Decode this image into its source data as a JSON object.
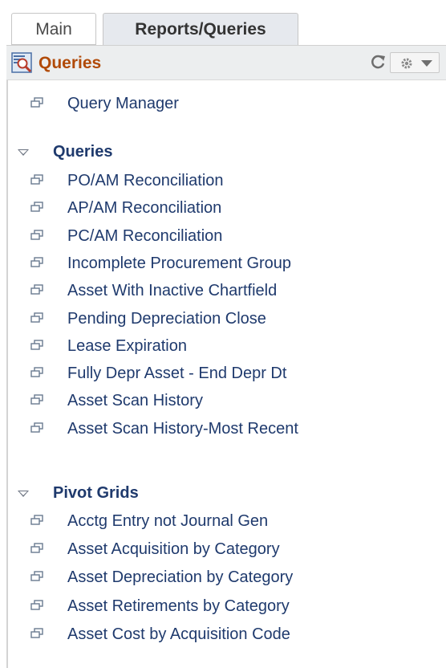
{
  "tabs": [
    {
      "label": "Main",
      "active": false
    },
    {
      "label": "Reports/Queries",
      "active": true
    }
  ],
  "header": {
    "title": "Queries",
    "icon": "query-report-icon",
    "title_color": "#b14a08"
  },
  "top_link": {
    "label": "Query Manager",
    "icon": "link-icon"
  },
  "groups": [
    {
      "title": "Queries",
      "expanded": true,
      "items": [
        "PO/AM Reconciliation",
        "AP/AM Reconciliation",
        "PC/AM Reconciliation",
        "Incomplete Procurement Group",
        "Asset With Inactive Chartfield",
        "Pending Depreciation Close",
        "Lease Expiration",
        "Fully Depr Asset - End Depr Dt",
        "Asset Scan History",
        "Asset Scan History-Most Recent"
      ]
    },
    {
      "title": "Pivot Grids",
      "expanded": true,
      "items": [
        "Acctg Entry not Journal Gen",
        "Asset Acquisition by Category",
        "Asset Depreciation by Category",
        "Asset Retirements by Category",
        "Asset Cost by Acquisition Code"
      ]
    }
  ],
  "colors": {
    "link": "#1f3a6d",
    "header_bg": "#eceeef",
    "tab_active_bg": "#e6e9ee"
  }
}
